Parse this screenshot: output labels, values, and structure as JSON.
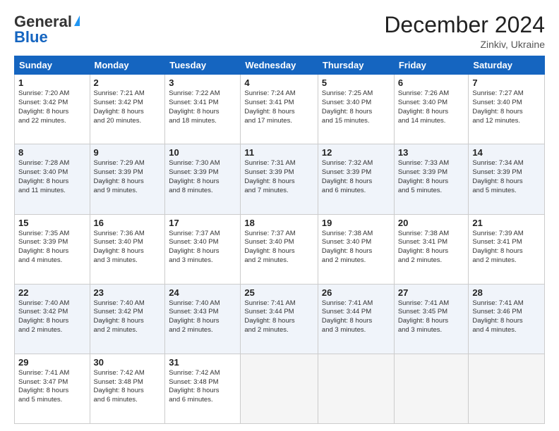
{
  "header": {
    "logo_general": "General",
    "logo_blue": "Blue",
    "month_title": "December 2024",
    "subtitle": "Zinkiv, Ukraine"
  },
  "weekdays": [
    "Sunday",
    "Monday",
    "Tuesday",
    "Wednesday",
    "Thursday",
    "Friday",
    "Saturday"
  ],
  "weeks": [
    [
      {
        "day": "1",
        "lines": [
          "Sunrise: 7:20 AM",
          "Sunset: 3:42 PM",
          "Daylight: 8 hours",
          "and 22 minutes."
        ]
      },
      {
        "day": "2",
        "lines": [
          "Sunrise: 7:21 AM",
          "Sunset: 3:42 PM",
          "Daylight: 8 hours",
          "and 20 minutes."
        ]
      },
      {
        "day": "3",
        "lines": [
          "Sunrise: 7:22 AM",
          "Sunset: 3:41 PM",
          "Daylight: 8 hours",
          "and 18 minutes."
        ]
      },
      {
        "day": "4",
        "lines": [
          "Sunrise: 7:24 AM",
          "Sunset: 3:41 PM",
          "Daylight: 8 hours",
          "and 17 minutes."
        ]
      },
      {
        "day": "5",
        "lines": [
          "Sunrise: 7:25 AM",
          "Sunset: 3:40 PM",
          "Daylight: 8 hours",
          "and 15 minutes."
        ]
      },
      {
        "day": "6",
        "lines": [
          "Sunrise: 7:26 AM",
          "Sunset: 3:40 PM",
          "Daylight: 8 hours",
          "and 14 minutes."
        ]
      },
      {
        "day": "7",
        "lines": [
          "Sunrise: 7:27 AM",
          "Sunset: 3:40 PM",
          "Daylight: 8 hours",
          "and 12 minutes."
        ]
      }
    ],
    [
      {
        "day": "8",
        "lines": [
          "Sunrise: 7:28 AM",
          "Sunset: 3:40 PM",
          "Daylight: 8 hours",
          "and 11 minutes."
        ]
      },
      {
        "day": "9",
        "lines": [
          "Sunrise: 7:29 AM",
          "Sunset: 3:39 PM",
          "Daylight: 8 hours",
          "and 9 minutes."
        ]
      },
      {
        "day": "10",
        "lines": [
          "Sunrise: 7:30 AM",
          "Sunset: 3:39 PM",
          "Daylight: 8 hours",
          "and 8 minutes."
        ]
      },
      {
        "day": "11",
        "lines": [
          "Sunrise: 7:31 AM",
          "Sunset: 3:39 PM",
          "Daylight: 8 hours",
          "and 7 minutes."
        ]
      },
      {
        "day": "12",
        "lines": [
          "Sunrise: 7:32 AM",
          "Sunset: 3:39 PM",
          "Daylight: 8 hours",
          "and 6 minutes."
        ]
      },
      {
        "day": "13",
        "lines": [
          "Sunrise: 7:33 AM",
          "Sunset: 3:39 PM",
          "Daylight: 8 hours",
          "and 5 minutes."
        ]
      },
      {
        "day": "14",
        "lines": [
          "Sunrise: 7:34 AM",
          "Sunset: 3:39 PM",
          "Daylight: 8 hours",
          "and 5 minutes."
        ]
      }
    ],
    [
      {
        "day": "15",
        "lines": [
          "Sunrise: 7:35 AM",
          "Sunset: 3:39 PM",
          "Daylight: 8 hours",
          "and 4 minutes."
        ]
      },
      {
        "day": "16",
        "lines": [
          "Sunrise: 7:36 AM",
          "Sunset: 3:40 PM",
          "Daylight: 8 hours",
          "and 3 minutes."
        ]
      },
      {
        "day": "17",
        "lines": [
          "Sunrise: 7:37 AM",
          "Sunset: 3:40 PM",
          "Daylight: 8 hours",
          "and 3 minutes."
        ]
      },
      {
        "day": "18",
        "lines": [
          "Sunrise: 7:37 AM",
          "Sunset: 3:40 PM",
          "Daylight: 8 hours",
          "and 2 minutes."
        ]
      },
      {
        "day": "19",
        "lines": [
          "Sunrise: 7:38 AM",
          "Sunset: 3:40 PM",
          "Daylight: 8 hours",
          "and 2 minutes."
        ]
      },
      {
        "day": "20",
        "lines": [
          "Sunrise: 7:38 AM",
          "Sunset: 3:41 PM",
          "Daylight: 8 hours",
          "and 2 minutes."
        ]
      },
      {
        "day": "21",
        "lines": [
          "Sunrise: 7:39 AM",
          "Sunset: 3:41 PM",
          "Daylight: 8 hours",
          "and 2 minutes."
        ]
      }
    ],
    [
      {
        "day": "22",
        "lines": [
          "Sunrise: 7:40 AM",
          "Sunset: 3:42 PM",
          "Daylight: 8 hours",
          "and 2 minutes."
        ]
      },
      {
        "day": "23",
        "lines": [
          "Sunrise: 7:40 AM",
          "Sunset: 3:42 PM",
          "Daylight: 8 hours",
          "and 2 minutes."
        ]
      },
      {
        "day": "24",
        "lines": [
          "Sunrise: 7:40 AM",
          "Sunset: 3:43 PM",
          "Daylight: 8 hours",
          "and 2 minutes."
        ]
      },
      {
        "day": "25",
        "lines": [
          "Sunrise: 7:41 AM",
          "Sunset: 3:44 PM",
          "Daylight: 8 hours",
          "and 2 minutes."
        ]
      },
      {
        "day": "26",
        "lines": [
          "Sunrise: 7:41 AM",
          "Sunset: 3:44 PM",
          "Daylight: 8 hours",
          "and 3 minutes."
        ]
      },
      {
        "day": "27",
        "lines": [
          "Sunrise: 7:41 AM",
          "Sunset: 3:45 PM",
          "Daylight: 8 hours",
          "and 3 minutes."
        ]
      },
      {
        "day": "28",
        "lines": [
          "Sunrise: 7:41 AM",
          "Sunset: 3:46 PM",
          "Daylight: 8 hours",
          "and 4 minutes."
        ]
      }
    ],
    [
      {
        "day": "29",
        "lines": [
          "Sunrise: 7:41 AM",
          "Sunset: 3:47 PM",
          "Daylight: 8 hours",
          "and 5 minutes."
        ]
      },
      {
        "day": "30",
        "lines": [
          "Sunrise: 7:42 AM",
          "Sunset: 3:48 PM",
          "Daylight: 8 hours",
          "and 6 minutes."
        ]
      },
      {
        "day": "31",
        "lines": [
          "Sunrise: 7:42 AM",
          "Sunset: 3:48 PM",
          "Daylight: 8 hours",
          "and 6 minutes."
        ]
      },
      null,
      null,
      null,
      null
    ]
  ]
}
